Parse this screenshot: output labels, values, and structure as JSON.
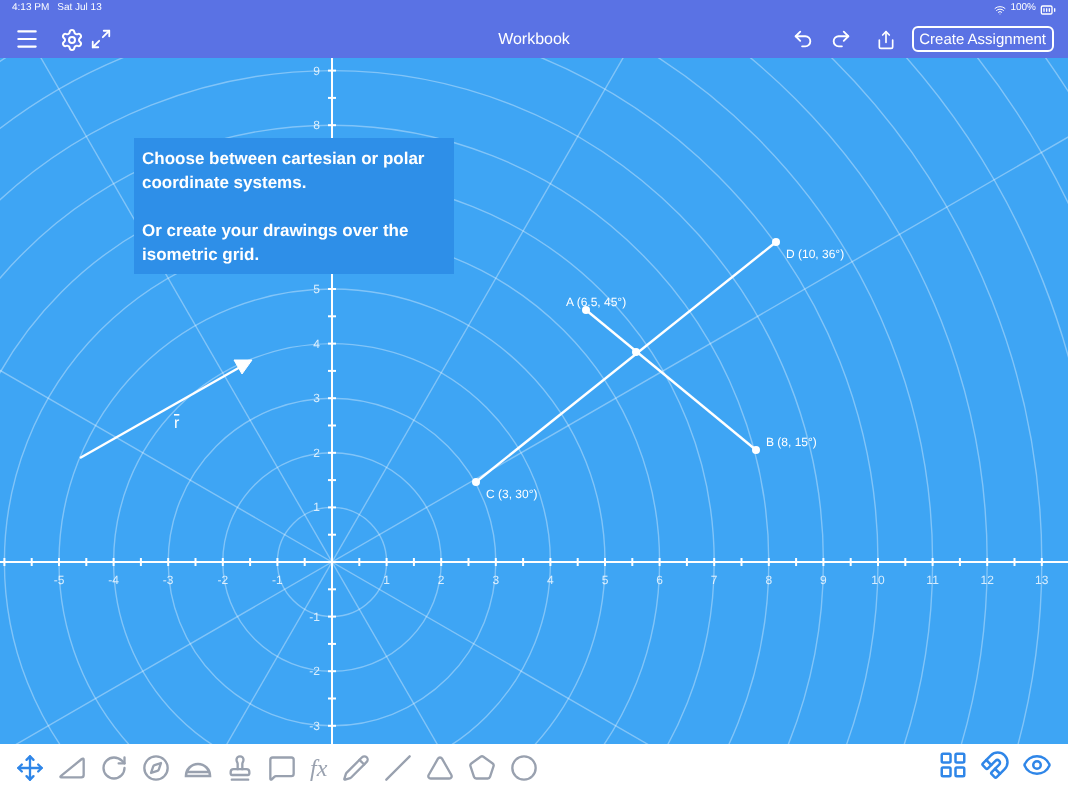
{
  "status_bar": {
    "time": "4:13 PM",
    "date": "Sat Jul 13",
    "battery": "100%"
  },
  "nav": {
    "title": "Workbook",
    "assign_button": "Create Assignment"
  },
  "hint": {
    "paragraphs": [
      "Choose between cartesian or polar coordinate systems.",
      "Or create your drawings over the isometric grid."
    ]
  },
  "axes": {
    "x_ticks": [
      "-5",
      "-4",
      "-3",
      "-2",
      "-1",
      "1",
      "2",
      "3",
      "4",
      "5",
      "6",
      "7",
      "8",
      "9",
      "10",
      "11",
      "12",
      "13"
    ],
    "y_ticks": [
      "9",
      "8",
      "5",
      "4",
      "3",
      "2",
      "1",
      "-1",
      "-2",
      "-3"
    ]
  },
  "points": [
    {
      "label": "A (6.5, 45°)"
    },
    {
      "label": "B (8, 15°)"
    },
    {
      "label": "C (3, 30°)"
    },
    {
      "label": "D (10, 36°)"
    }
  ],
  "vector": {
    "label": "r"
  },
  "tools": [
    {
      "kind": "move",
      "selected": true
    },
    {
      "kind": "ruler",
      "selected": false
    },
    {
      "kind": "rotate",
      "selected": false
    },
    {
      "kind": "compass",
      "selected": false
    },
    {
      "kind": "protractor",
      "selected": false
    },
    {
      "kind": "stamp",
      "selected": false
    },
    {
      "kind": "comment",
      "selected": false
    },
    {
      "kind": "function",
      "label": "fx",
      "selected": false
    },
    {
      "kind": "pencil",
      "selected": false
    },
    {
      "kind": "line",
      "selected": false
    },
    {
      "kind": "triangle",
      "selected": false
    },
    {
      "kind": "polygon",
      "selected": false
    },
    {
      "kind": "circle",
      "selected": false
    }
  ],
  "right_tools": [
    {
      "kind": "grid"
    },
    {
      "kind": "magnet"
    },
    {
      "kind": "eye"
    }
  ]
}
